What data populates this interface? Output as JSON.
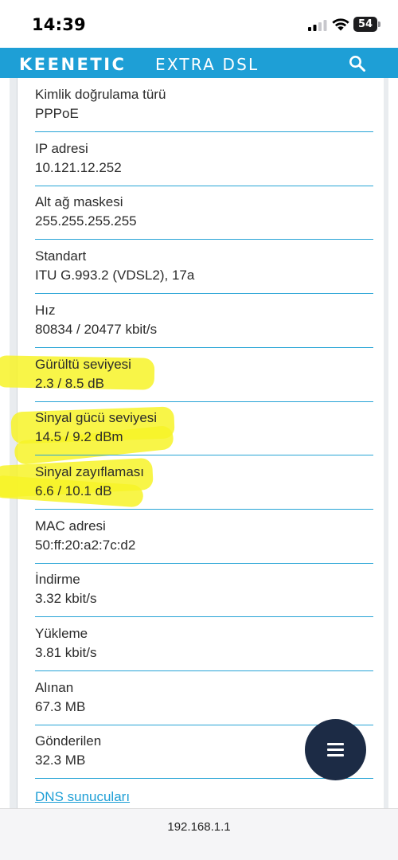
{
  "status_bar": {
    "time": "14:39",
    "battery": "54",
    "icons": [
      "cellular-signal-icon",
      "wifi-icon",
      "battery-icon"
    ]
  },
  "header": {
    "brand": "KEENETIC",
    "model": "EXTRA DSL",
    "search_icon": "search-icon",
    "background": "#1e9fd6"
  },
  "fields": [
    {
      "label": "Kimlik doğrulama türü",
      "value": "PPPoE"
    },
    {
      "label": "IP adresi",
      "value": "10.121.12.252"
    },
    {
      "label": "Alt ağ maskesi",
      "value": "255.255.255.255"
    },
    {
      "label": "Standart",
      "value": "ITU G.993.2 (VDSL2), 17a"
    },
    {
      "label": "Hız",
      "value": "80834 / 20477 kbit/s"
    },
    {
      "label": "Gürültü seviyesi",
      "value": "2.3 / 8.5 dB"
    },
    {
      "label": "Sinyal gücü seviyesi",
      "value": "14.5 / 9.2 dBm"
    },
    {
      "label": "Sinyal zayıflaması",
      "value": "6.6 / 10.1 dB"
    },
    {
      "label": "MAC adresi",
      "value": "50:ff:20:a2:7c:d2"
    },
    {
      "label": "İndirme",
      "value": "3.32 kbit/s"
    },
    {
      "label": "Yükleme",
      "value": "3.81 kbit/s"
    },
    {
      "label": "Alınan",
      "value": "67.3 MB"
    },
    {
      "label": "Gönderilen",
      "value": "32.3 MB"
    }
  ],
  "dns_link": "DNS sunucuları",
  "fab_icon": "menu-icon",
  "address_bar": {
    "url": "192.168.1.1"
  },
  "colors": {
    "accent": "#1e9fd6",
    "fab": "#1c2b45",
    "highlight": "#f7f328"
  }
}
